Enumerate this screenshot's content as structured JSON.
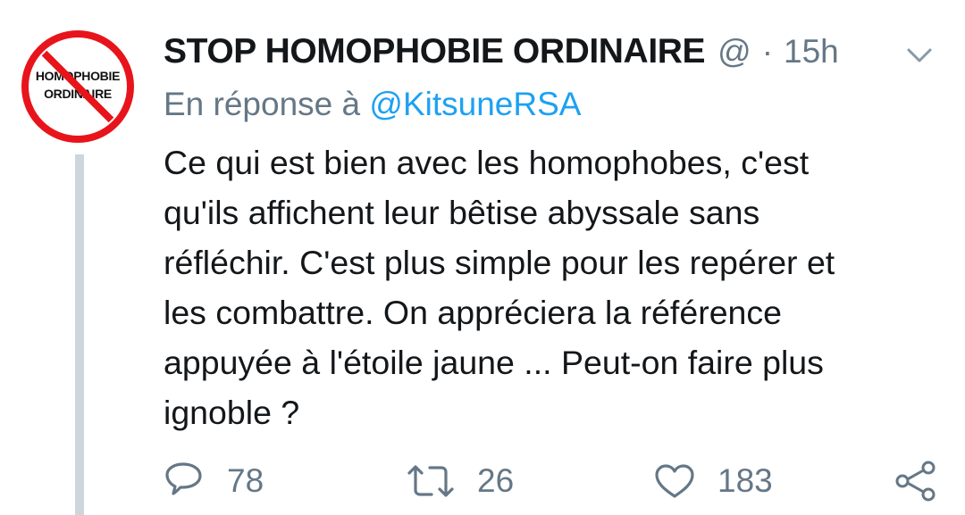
{
  "avatar": {
    "line1": "HOMOPHOBIE",
    "line2": "ORDINAIRE",
    "accent": "#e8141b"
  },
  "tweet": {
    "author_name": "STOP HOMOPHOBIE ORDINAIRE",
    "handle": "@",
    "separator": "·",
    "time": "15h",
    "reply_prefix": "En réponse à",
    "reply_mention": "@KitsuneRSA",
    "body_lines": [
      "Ce qui est bien avec les homophobes, c'est",
      "qu'ils affichent leur bêtise abyssale sans",
      "réfléchir. C'est plus simple pour les repérer et",
      "les combattre. On appréciera la référence",
      "appuyée à l'étoile jaune ... Peut-on faire plus",
      "ignoble ?"
    ]
  },
  "actions": {
    "reply_count": "78",
    "retweet_count": "26",
    "like_count": "183"
  },
  "icons": {
    "menu": "chevron-down-icon",
    "reply": "reply-icon",
    "retweet": "retweet-icon",
    "like": "heart-icon",
    "share": "share-icon"
  },
  "colors": {
    "text": "#14171a",
    "muted": "#657786",
    "link": "#1da1f2",
    "thread_line": "#ccd6dd"
  }
}
